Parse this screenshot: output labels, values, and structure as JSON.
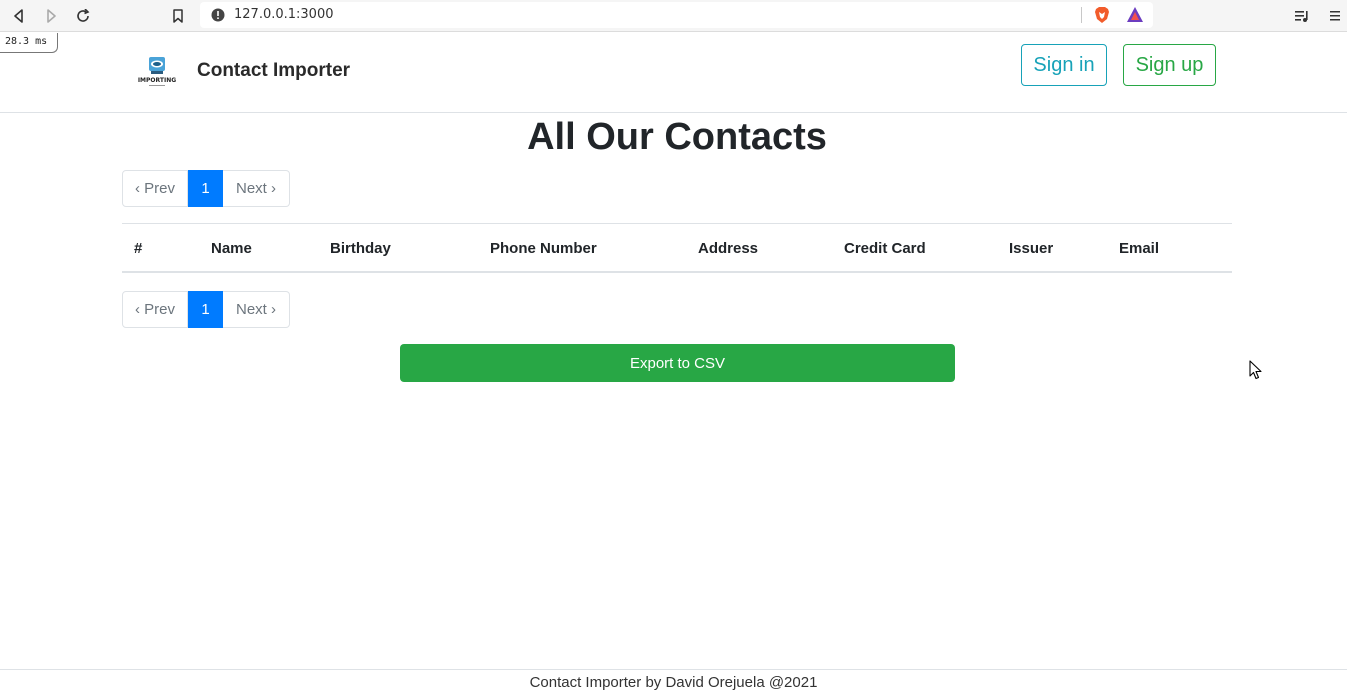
{
  "browser": {
    "url": "127.0.0.1:3000",
    "timing": "28.3 ms",
    "icons": [
      "back-icon",
      "forward-icon",
      "reload-icon",
      "bookmark-icon",
      "site-info-icon",
      "brave-shield-icon",
      "brave-rewards-icon",
      "media-icon",
      "menu-icon"
    ]
  },
  "header": {
    "brand": "Contact Importer",
    "logo_text": "IMPORTING",
    "sign_in": "Sign in",
    "sign_up": "Sign up"
  },
  "main": {
    "title": "All Our Contacts",
    "pagination": {
      "prev": "‹ Prev",
      "current": "1",
      "next": "Next ›"
    },
    "table": {
      "columns": [
        "#",
        "Name",
        "Birthday",
        "Phone Number",
        "Address",
        "Credit Card",
        "Issuer",
        "Email"
      ]
    },
    "export_button": "Export to CSV"
  },
  "footer": {
    "text": "Contact Importer by David Orejuela @2021"
  },
  "colors": {
    "primary": "#007bff",
    "success": "#28a745",
    "info": "#17a2b8"
  }
}
